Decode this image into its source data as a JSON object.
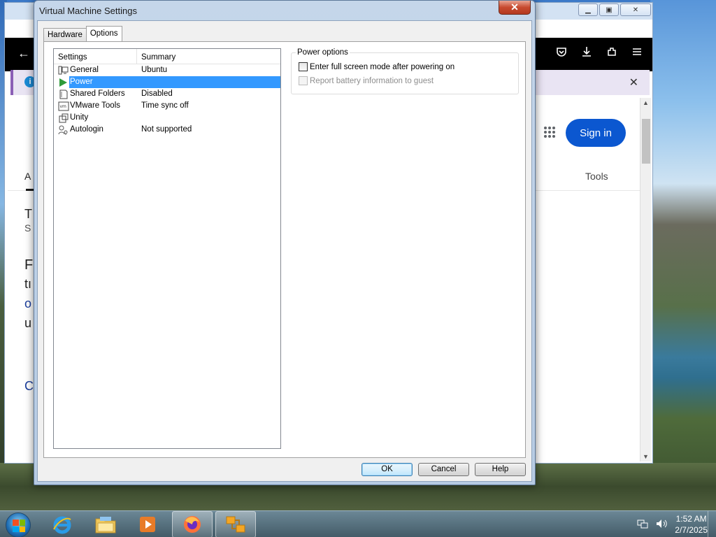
{
  "dialog": {
    "title": "Virtual Machine Settings",
    "close_glyph": "✕",
    "tabs": [
      {
        "label": "Hardware",
        "active": false
      },
      {
        "label": "Options",
        "active": true
      }
    ],
    "list": {
      "col_settings": "Settings",
      "col_summary": "Summary",
      "rows": [
        {
          "name": "General",
          "summary": "Ubuntu",
          "icon": "general-icon"
        },
        {
          "name": "Power",
          "summary": "",
          "icon": "power-play-icon",
          "selected": true
        },
        {
          "name": "Shared Folders",
          "summary": "Disabled",
          "icon": "shared-folders-icon"
        },
        {
          "name": "VMware Tools",
          "summary": "Time sync off",
          "icon": "vmware-tools-icon"
        },
        {
          "name": "Unity",
          "summary": "",
          "icon": "unity-icon"
        },
        {
          "name": "Autologin",
          "summary": "Not supported",
          "icon": "autologin-icon"
        }
      ]
    },
    "power_options": {
      "title": "Power options",
      "fullscreen_label": "Enter full screen mode after powering on",
      "fullscreen_checked": false,
      "battery_label": "Report battery information to guest",
      "battery_enabled": false
    },
    "buttons": {
      "ok": "OK",
      "cancel": "Cancel",
      "help": "Help"
    }
  },
  "browser": {
    "sign_in": "Sign in",
    "tools": "Tools",
    "notify_info": "i",
    "notify_close": "✕",
    "peek_chars": [
      "A",
      "T",
      "S",
      "F",
      "tı",
      "o",
      "u",
      "C"
    ]
  },
  "taskbar": {
    "time": "1:52 AM",
    "date": "2/7/2025",
    "apps": [
      "internet-explorer-icon",
      "file-explorer-icon",
      "media-player-icon",
      "firefox-icon",
      "vmware-icon"
    ]
  },
  "colors": {
    "selection": "#3399ff",
    "signin": "#0b57d0",
    "accent_power": "#2e9b3a"
  }
}
